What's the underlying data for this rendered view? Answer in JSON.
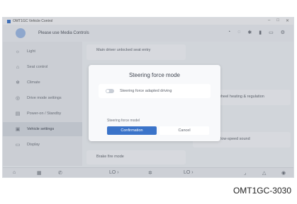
{
  "window": {
    "title": "OMT1GC Vehicle Control"
  },
  "header": {
    "welcome": "Please use Media Controls"
  },
  "sidebar": {
    "items": [
      {
        "label": "Light",
        "icon": "light-icon"
      },
      {
        "label": "Seat control",
        "icon": "seat-icon"
      },
      {
        "label": "Climate",
        "icon": "climate-icon"
      },
      {
        "label": "Drive mode settings",
        "icon": "drive-icon"
      },
      {
        "label": "Power-on / Standby",
        "icon": "power-icon"
      },
      {
        "label": "Vehicle settings",
        "icon": "vehicle-settings-icon"
      },
      {
        "label": "Display",
        "icon": "display-icon"
      }
    ]
  },
  "content": {
    "card1": "Main driver unlocked seat entry",
    "card2": "Steering wheel heating & regulation",
    "card3": "Intelligent low-speed sound",
    "card4": "Brake fire mode"
  },
  "dialog": {
    "title": "Steering force mode",
    "row_label": "Steering force adapted driving",
    "option_label": "Steering force model",
    "confirm_label": "Confirmation",
    "cancel_label": "Cancel"
  },
  "bottombar": {
    "left_temp": "LO",
    "right_temp": "LO"
  },
  "caption": "OMT1GC-3030",
  "colors": {
    "accent": "#3a73c9",
    "sidebar_active": "#d3d8e0"
  }
}
